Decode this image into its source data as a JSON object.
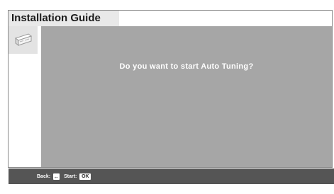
{
  "header": {
    "title": "Installation Guide",
    "icon": "tools-icon"
  },
  "dialog": {
    "prompt": "Do you want to start Auto Tuning?"
  },
  "footer": {
    "back_label": "Back:",
    "back_key": "←",
    "start_label": "Start:",
    "start_key": "OK"
  },
  "colors": {
    "panel": "#a6a6a6",
    "footer": "#555555",
    "title_tab": "#e9e9e9",
    "icon_box": "#e3e3e3"
  }
}
